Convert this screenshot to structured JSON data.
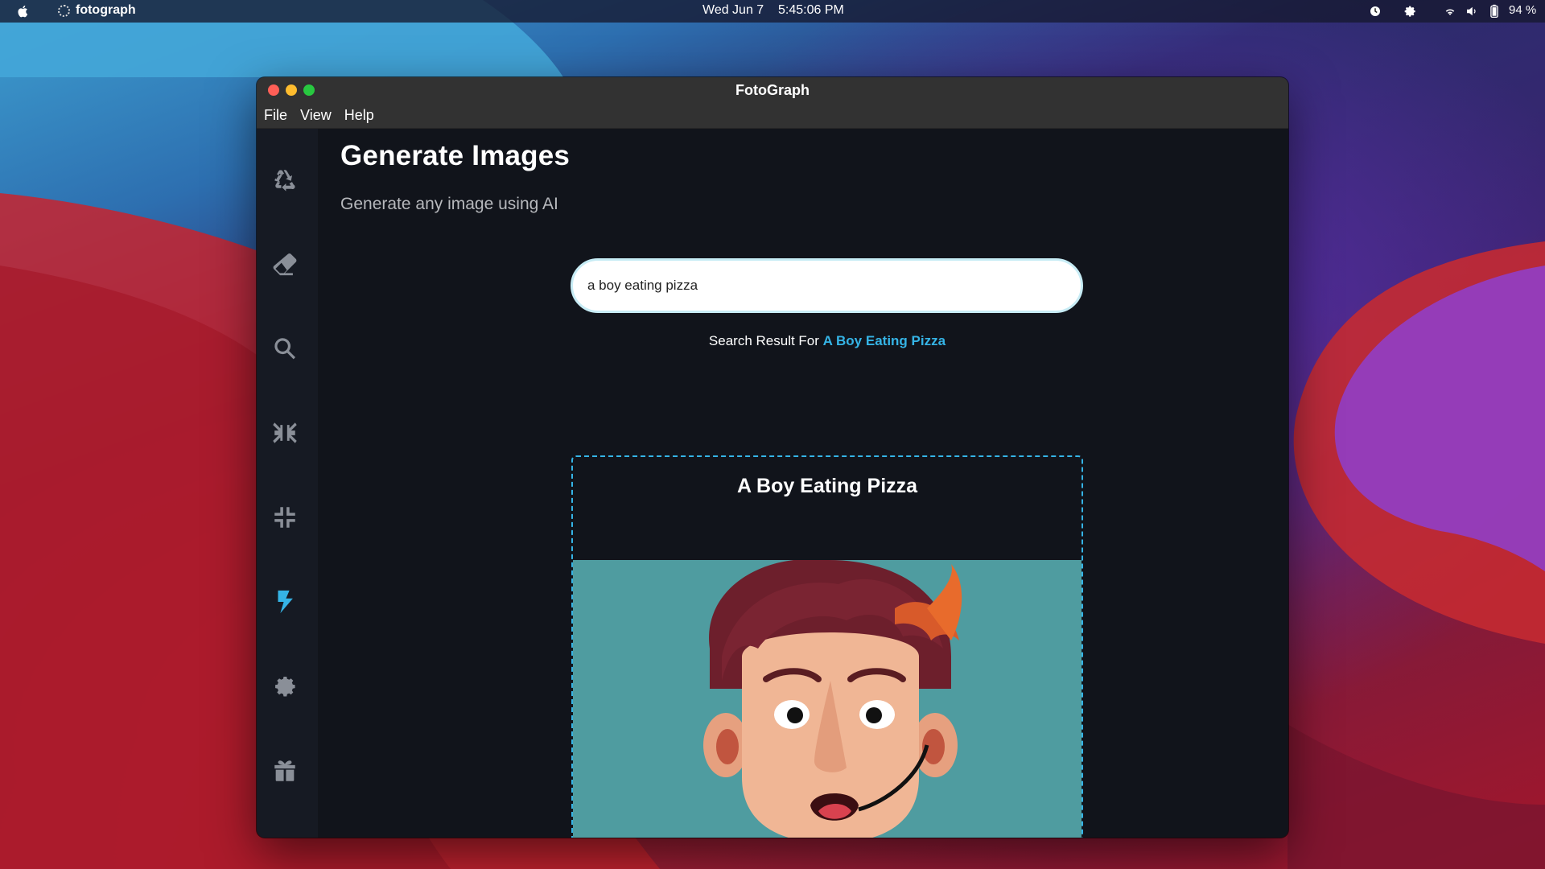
{
  "menubar": {
    "app_name": "fotograph",
    "date": "Wed Jun 7",
    "time": "5:45:06 PM",
    "battery": "94 %"
  },
  "window": {
    "title": "FotoGraph",
    "menu": [
      "File",
      "View",
      "Help"
    ]
  },
  "sidebar": {
    "items": [
      {
        "icon": "recycle-icon"
      },
      {
        "icon": "eraser-icon"
      },
      {
        "icon": "search-icon"
      },
      {
        "icon": "compress-arrows-icon"
      },
      {
        "icon": "compress-icon"
      },
      {
        "icon": "bolt-icon",
        "active": true
      },
      {
        "icon": "gear-icon"
      },
      {
        "icon": "gift-icon"
      }
    ]
  },
  "main": {
    "title": "Generate Images",
    "subtitle": "Generate any image using AI",
    "search_value": "a boy eating pizza",
    "result_prefix": "Search Result For",
    "result_query": "A Boy Eating Pizza",
    "card_title": "A Boy Eating Pizza"
  },
  "colors": {
    "accent": "#35b4e6",
    "window_bg": "#11141b",
    "sidebar_bg": "#161a23",
    "image_bg": "#4f9ca0"
  }
}
